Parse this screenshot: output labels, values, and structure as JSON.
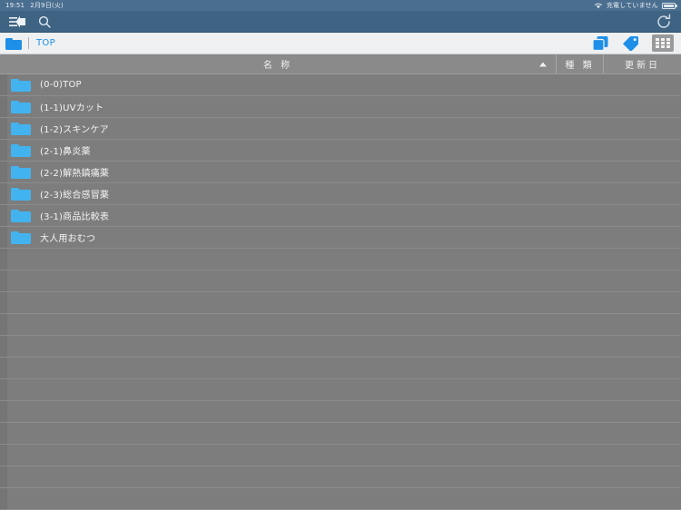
{
  "statusbar": {
    "time": "19:51",
    "date": "2月9日(火)",
    "wifi_icon": "wifi-icon",
    "battery_label": "充電していません",
    "battery_icon": "battery-icon"
  },
  "navbar": {
    "menu_icon": "menu-collapse-icon",
    "search_icon": "search-icon",
    "refresh_icon": "refresh-icon"
  },
  "breadcrumb": {
    "folder_icon": "folder-icon",
    "path": "TOP",
    "copy_icon": "copy-stack-icon",
    "tag_icon": "tag-icon",
    "grid_icon": "grid-view-icon"
  },
  "columns": {
    "name": "名 称",
    "sort_indicator": "▲",
    "type": "種 類",
    "updated": "更新日"
  },
  "list": {
    "items": [
      {
        "name": "(0-0)TOP",
        "icon": "folder-icon"
      },
      {
        "name": "(1-1)UVカット",
        "icon": "folder-icon"
      },
      {
        "name": "(1-2)スキンケア",
        "icon": "folder-icon"
      },
      {
        "name": "(2-1)鼻炎薬",
        "icon": "folder-icon"
      },
      {
        "name": "(2-2)解熱鎮痛薬",
        "icon": "folder-icon"
      },
      {
        "name": "(2-3)総合感冒薬",
        "icon": "folder-icon"
      },
      {
        "name": "(3-1)商品比較表",
        "icon": "folder-icon"
      },
      {
        "name": "大人用おむつ",
        "icon": "folder-icon"
      }
    ],
    "empty_row_count": 12
  },
  "colors": {
    "status_bar": "#4a6e8f",
    "nav_bar": "#3f6383",
    "breadcrumb_bg": "#eef0f2",
    "accent_blue": "#1e8fe8",
    "folder_blue": "#42b3ef",
    "list_bg": "#7d7d7d",
    "header_bg": "#8a8a8a"
  }
}
